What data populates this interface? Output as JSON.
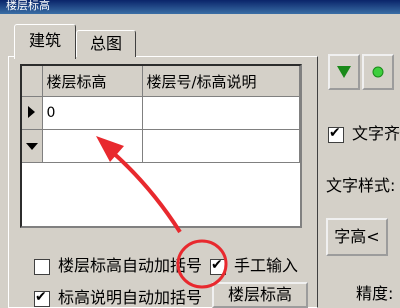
{
  "window": {
    "title": "楼层标高"
  },
  "tabs": [
    {
      "label": "建筑"
    },
    {
      "label": "总图"
    }
  ],
  "grid": {
    "headers": [
      "楼层标高",
      "楼层号/标高说明"
    ],
    "rows": [
      {
        "elevation": "0",
        "note": ""
      },
      {
        "elevation": "",
        "note": ""
      }
    ]
  },
  "options": {
    "auto_bracket_elevation": {
      "label": "楼层标高自动加括号",
      "checked": false
    },
    "manual_input": {
      "label": "手工输入",
      "checked": true
    },
    "auto_bracket_note": {
      "label": "标高说明自动加括号",
      "checked": true
    },
    "floor_elevation_button": "楼层标高"
  },
  "right_panel": {
    "text_align": {
      "label": "文字齐线",
      "checked": true
    },
    "text_style_label": "文字样式:",
    "text_height_button": "字高<",
    "precision_label": "精度:"
  },
  "colors": {
    "marker": "#1a8a1a",
    "annotation": "#e8292e"
  },
  "icons": [
    "triangle-down-icon",
    "circle-icon"
  ]
}
